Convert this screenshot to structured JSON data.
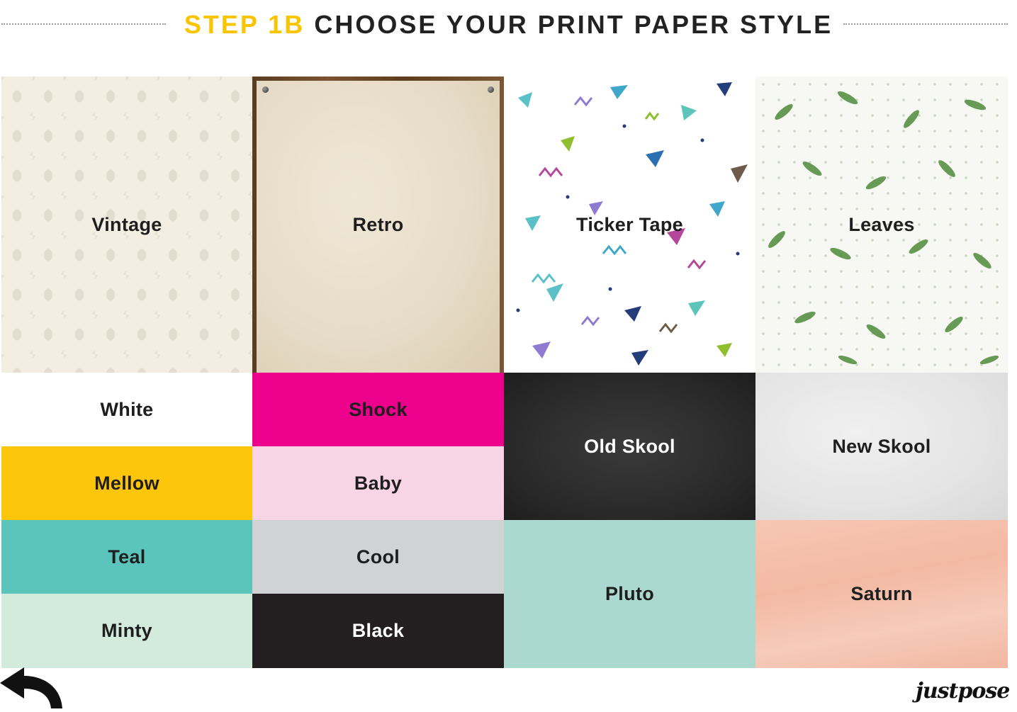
{
  "header": {
    "step": "STEP 1B",
    "title": "CHOOSE YOUR PRINT PAPER STYLE"
  },
  "styles": {
    "vintage": "Vintage",
    "retro": "Retro",
    "ticker_tape": "Ticker Tape",
    "leaves": "Leaves",
    "white": "White",
    "shock": "Shock",
    "old_skool": "Old Skool",
    "new_skool": "New Skool",
    "mellow": "Mellow",
    "baby": "Baby",
    "teal": "Teal",
    "cool": "Cool",
    "pluto": "Pluto",
    "saturn": "Saturn",
    "minty": "Minty",
    "black": "Black"
  },
  "colors": {
    "accent": "#f9c400",
    "white": "#ffffff",
    "shock": "#ec008c",
    "mellow": "#fec60b",
    "baby": "#f8d4e4",
    "teal": "#5bc5bc",
    "cool": "#d1d2d4",
    "pluto": "#acd9cf",
    "minty": "#d2ebdd",
    "black": "#231f20"
  },
  "footer": {
    "back_icon": "back-arrow-icon",
    "logo": "justpose"
  }
}
